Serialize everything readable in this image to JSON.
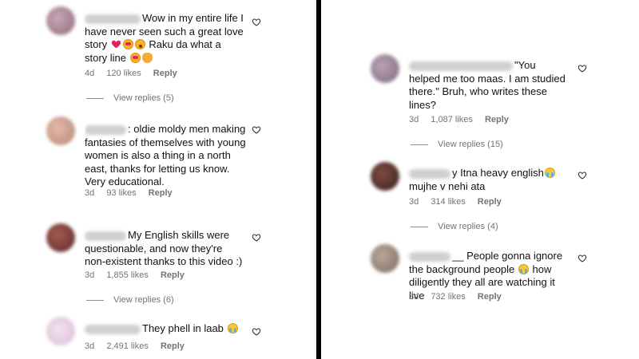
{
  "left_column": {
    "comments": [
      {
        "text": "Wow in my entire life I have never seen such a great love story",
        "text_tail": "Raku da what a story line",
        "meta": {
          "time": "4d",
          "likes": "120 likes",
          "reply": "Reply"
        },
        "view_replies": "View replies (5)"
      },
      {
        "text": ": oldie moldy men making fantasies of themselves with young women is also a thing in a north east, thanks for letting us know. Very educational.",
        "meta": {
          "time": "3d",
          "likes": "93 likes",
          "reply": "Reply"
        }
      },
      {
        "text": "My English skills were questionable, and now they're non-existent thanks to this video :)",
        "meta": {
          "time": "3d",
          "likes": "1,855 likes",
          "reply": "Reply"
        },
        "view_replies": "View replies (6)"
      },
      {
        "text": "They phell in laab",
        "meta": {
          "time": "3d",
          "likes": "2,491 likes",
          "reply": "Reply"
        }
      }
    ]
  },
  "right_column": {
    "comments": [
      {
        "text": "\"You helped me too maas. I am studied there.\" Bruh, who writes these lines?",
        "meta": {
          "time": "3d",
          "likes": "1,087 likes",
          "reply": "Reply"
        },
        "view_replies": "View replies (15)"
      },
      {
        "text": "y Itna heavy english",
        "text_tail": "mujhe v nehi ata",
        "meta": {
          "time": "3d",
          "likes": "314 likes",
          "reply": "Reply"
        },
        "view_replies": "View replies (4)"
      },
      {
        "text": "__ People gonna ignore the background people",
        "text_tail": "how diligently they all are watching it live",
        "meta": {
          "time": "3d",
          "likes": "732 likes",
          "reply": "Reply"
        }
      }
    ]
  },
  "icons": {
    "like": "heart-outline-icon",
    "emoji": [
      "red-heart-emoji",
      "heart-eyes-emoji",
      "astonished-emoji",
      "clapping-hands-emoji",
      "loudly-crying-emoji"
    ]
  },
  "colors": {
    "text": "#111111",
    "meta": "#737373",
    "divider": "#000000"
  }
}
